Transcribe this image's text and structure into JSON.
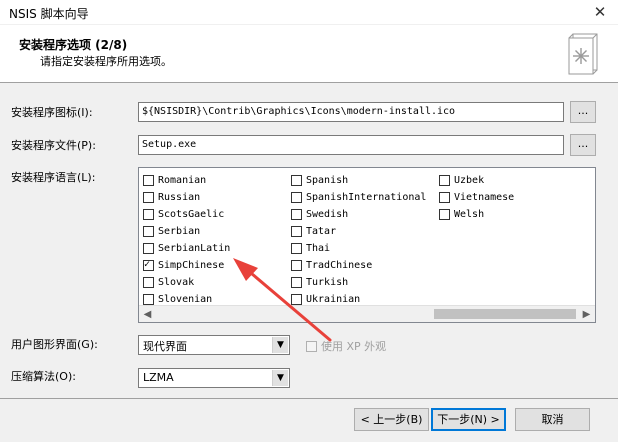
{
  "window": {
    "title": "NSIS 脚本向导",
    "close_glyph": "✕"
  },
  "header": {
    "title": "安装程序选项 (2/8)",
    "subtitle": "请指定安装程序所用选项。",
    "icon": "installer-book-icon"
  },
  "form": {
    "icon_label": "安装程序图标(I):",
    "icon_value": "${NSISDIR}\\Contrib\\Graphics\\Icons\\modern-install.ico",
    "icon_browse": "...",
    "file_label": "安装程序文件(P):",
    "file_value": "Setup.exe",
    "file_browse": "...",
    "lang_label": "安装程序语言(L):",
    "ui_label": "用户图形界面(G):",
    "ui_value": "现代界面",
    "xp_label": "使用 XP 外观",
    "compress_label": "压缩算法(O):",
    "compress_value": "LZMA"
  },
  "languages": {
    "col1": [
      {
        "name": "Romanian",
        "checked": false
      },
      {
        "name": "Russian",
        "checked": false
      },
      {
        "name": "ScotsGaelic",
        "checked": false
      },
      {
        "name": "Serbian",
        "checked": false
      },
      {
        "name": "SerbianLatin",
        "checked": false
      },
      {
        "name": "SimpChinese",
        "checked": true
      },
      {
        "name": "Slovak",
        "checked": false
      },
      {
        "name": "Slovenian",
        "checked": false
      }
    ],
    "col2": [
      {
        "name": "Spanish",
        "checked": false
      },
      {
        "name": "SpanishInternational",
        "checked": false
      },
      {
        "name": "Swedish",
        "checked": false
      },
      {
        "name": "Tatar",
        "checked": false
      },
      {
        "name": "Thai",
        "checked": false
      },
      {
        "name": "TradChinese",
        "checked": false
      },
      {
        "name": "Turkish",
        "checked": false
      },
      {
        "name": "Ukrainian",
        "checked": false
      }
    ],
    "col3": [
      {
        "name": "Uzbek",
        "checked": false
      },
      {
        "name": "Vietnamese",
        "checked": false
      },
      {
        "name": "Welsh",
        "checked": false
      }
    ]
  },
  "buttons": {
    "back": "< 上一步(B)",
    "next": "下一步(N) >",
    "cancel": "取消"
  },
  "annotation": {
    "color": "#e8413a"
  }
}
